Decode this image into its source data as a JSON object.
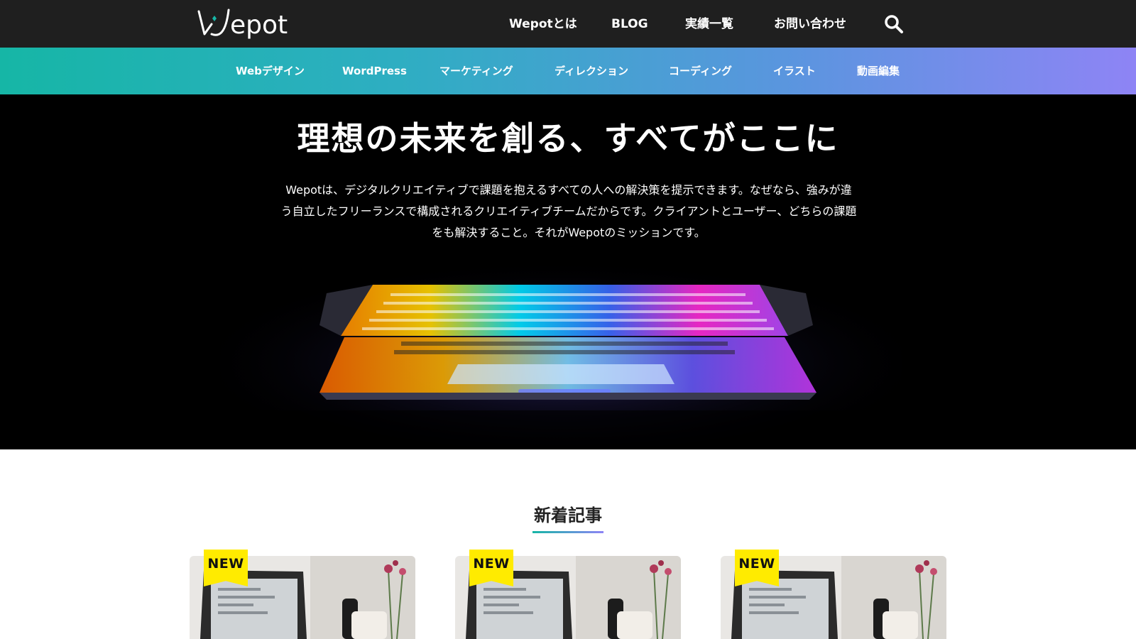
{
  "header": {
    "logo_text": "Wepot",
    "nav": [
      "Wepotとは",
      "BLOG",
      "実績一覧",
      "お問い合わせ"
    ],
    "search_icon": "search-icon"
  },
  "categories": [
    "Webデザイン",
    "WordPress",
    "マーケティング",
    "ディレクション",
    "コーディング",
    "イラスト",
    "動画編集"
  ],
  "hero": {
    "title": "理想の未来を創る、すべてがここに",
    "description": "Wepotは、デジタルクリエイティブで課題を抱えるすべての人への解決策を提示できます。なぜなら、強みが違う自立したフリーランスで構成されるクリエイティブチームだからです。クライアントとユーザー、どちらの課題をも解決すること。それがWepotのミッションです。"
  },
  "new_articles": {
    "title": "新着記事",
    "badge": "NEW",
    "cards": [
      {
        "badge": "NEW"
      },
      {
        "badge": "NEW"
      },
      {
        "badge": "NEW"
      }
    ]
  },
  "colors": {
    "header_bg": "#1f1f1f",
    "gradient_start": "#16b6a6",
    "gradient_end": "#8e84f5",
    "badge": "#ffeb00"
  }
}
